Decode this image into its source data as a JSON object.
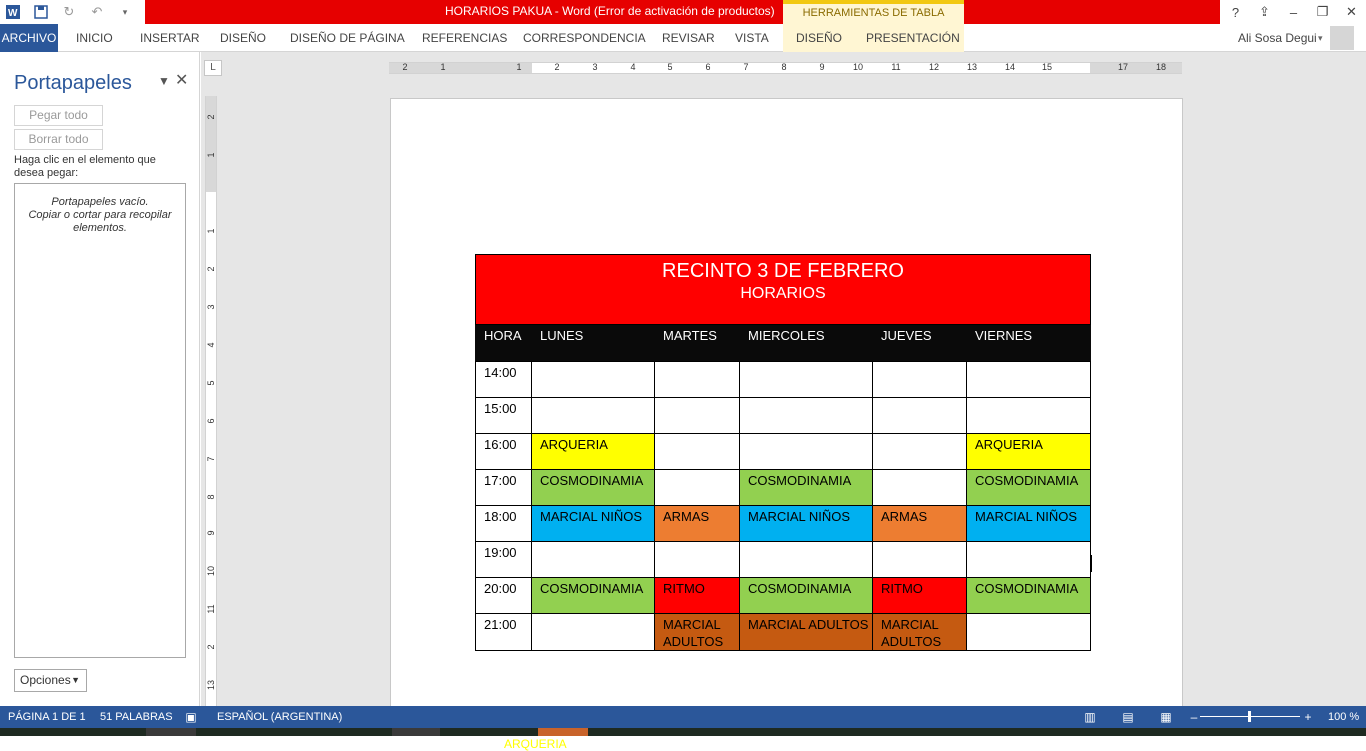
{
  "titlebar": {
    "title": "HORARIOS PAKUA -  Word (Error de activación de productos)",
    "tool_tab": "HERRAMIENTAS DE TABLA",
    "controls": [
      "?",
      "⇪",
      "–",
      "❐",
      "✕"
    ]
  },
  "ribbon": {
    "tabs": [
      "ARCHIVO",
      "INICIO",
      "INSERTAR",
      "DISEÑO",
      "DISEÑO DE PÁGINA",
      "REFERENCIAS",
      "CORRESPONDENCIA",
      "REVISAR",
      "VISTA",
      "DISEÑO",
      "PRESENTACIÓN"
    ],
    "user": "Ali Sosa Degui"
  },
  "clipboard": {
    "title": "Portapapeles",
    "paste_all": "Pegar todo",
    "clear_all": "Borrar todo",
    "hint": "Haga clic en el elemento que desea pegar:",
    "empty_line1": "Portapapeles vacío.",
    "empty_line2": "Copiar o cortar para recopilar elementos.",
    "options": "Opciones"
  },
  "ruler": {
    "h_labels": [
      "2",
      "1",
      "1",
      "2",
      "3",
      "4",
      "5",
      "6",
      "7",
      "8",
      "9",
      "10",
      "11",
      "12",
      "13",
      "14",
      "15",
      "17",
      "18"
    ],
    "v_labels": [
      "2",
      "1",
      "1",
      "2",
      "3",
      "4",
      "5",
      "6",
      "7",
      "8",
      "9",
      "10",
      "11",
      "2",
      "13"
    ]
  },
  "schedule": {
    "title": "RECINTO 3 DE FEBRERO",
    "subtitle": "HORARIOS",
    "columns": [
      "HORA",
      "LUNES",
      "MARTES",
      "MIERCOLES",
      "JUEVES",
      "VIERNES"
    ],
    "rows": [
      {
        "time": "14:00",
        "cells": [
          "",
          "",
          "",
          "",
          ""
        ]
      },
      {
        "time": "15:00",
        "cells": [
          "",
          "",
          "",
          "",
          ""
        ]
      },
      {
        "time": "16:00",
        "cells": [
          "ARQUERIA",
          "",
          "",
          "",
          "ARQUERIA"
        ]
      },
      {
        "time": "17:00",
        "cells": [
          "COSMODINAMIA",
          "",
          "COSMODINAMIA",
          "",
          "COSMODINAMIA"
        ]
      },
      {
        "time": "18:00",
        "cells": [
          "MARCIAL NIÑOS",
          "ARMAS",
          "MARCIAL NIÑOS",
          "ARMAS",
          "MARCIAL NIÑOS"
        ]
      },
      {
        "time": "19:00",
        "cells": [
          "",
          "",
          "",
          "",
          ""
        ]
      },
      {
        "time": "20:00",
        "cells": [
          "COSMODINAMIA",
          "RITMO",
          "COSMODINAMIA",
          "RITMO",
          "COSMODINAMIA"
        ]
      },
      {
        "time": "21:00",
        "cells": [
          "",
          "MARCIAL ADULTOS",
          "MARCIAL ADULTOS",
          "MARCIAL ADULTOS",
          ""
        ]
      }
    ],
    "activity_colors": {
      "ARQUERIA": "#ffff00",
      "COSMODINAMIA": "#92d050",
      "MARCIAL NIÑOS": "#00b0f0",
      "ARMAS": "#ed7d31",
      "RITMO": "#ff0000",
      "MARCIAL ADULTOS": "#c55a11"
    },
    "below_text": "ARQUERIA"
  },
  "statusbar": {
    "page": "PÁGINA 1 DE 1",
    "words": "51 PALABRAS",
    "language": "ESPAÑOL (ARGENTINA)",
    "zoom": "100 %"
  },
  "colors": {
    "word_blue": "#2b579a",
    "title_red": "#e60000"
  }
}
